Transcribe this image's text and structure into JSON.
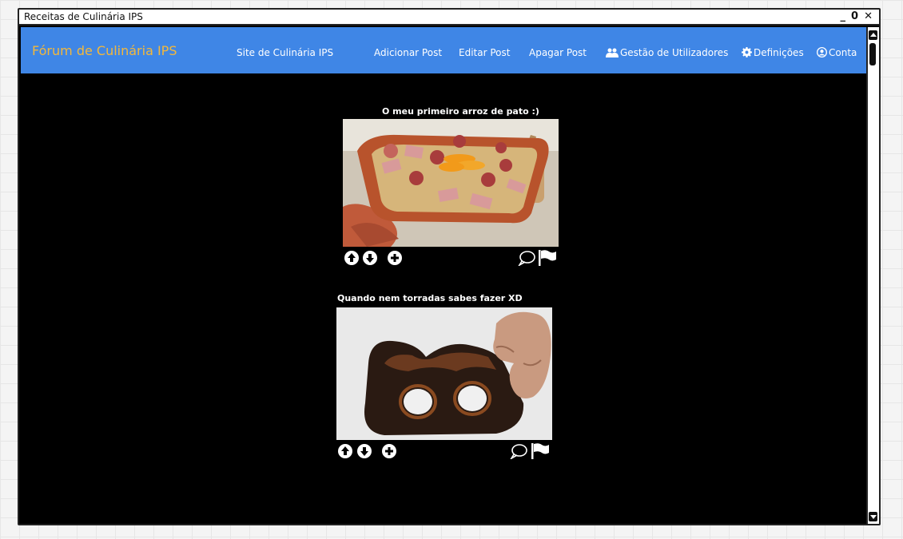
{
  "window": {
    "title": "Receitas de Culinária IPS",
    "minimize": "_",
    "maximize": "0",
    "close": "✕"
  },
  "navbar": {
    "brand": "Fórum de Culinária IPS",
    "links": [
      "Site de Culinária IPS",
      "Adicionar Post",
      "Editar Post",
      "Apagar Post",
      "Gestão de Utilizadores",
      "Definições",
      "Conta"
    ],
    "icons": [
      "users-icon",
      "gear-icon",
      "account-icon"
    ]
  },
  "posts": [
    {
      "title": "O meu primeiro arroz de pato :)",
      "image": "arroz-de-pato-photo",
      "actions": [
        "upvote-icon",
        "downvote-icon",
        "add-icon",
        "comment-icon",
        "flag-icon"
      ]
    },
    {
      "title": "Quando nem torradas sabes fazer XD",
      "image": "burnt-toast-photo",
      "actions": [
        "upvote-icon",
        "downvote-icon",
        "add-icon",
        "comment-icon",
        "flag-icon"
      ]
    }
  ],
  "colors": {
    "navbar": "#3f86e6",
    "brand": "#f3b83b",
    "content_bg": "#000000"
  }
}
